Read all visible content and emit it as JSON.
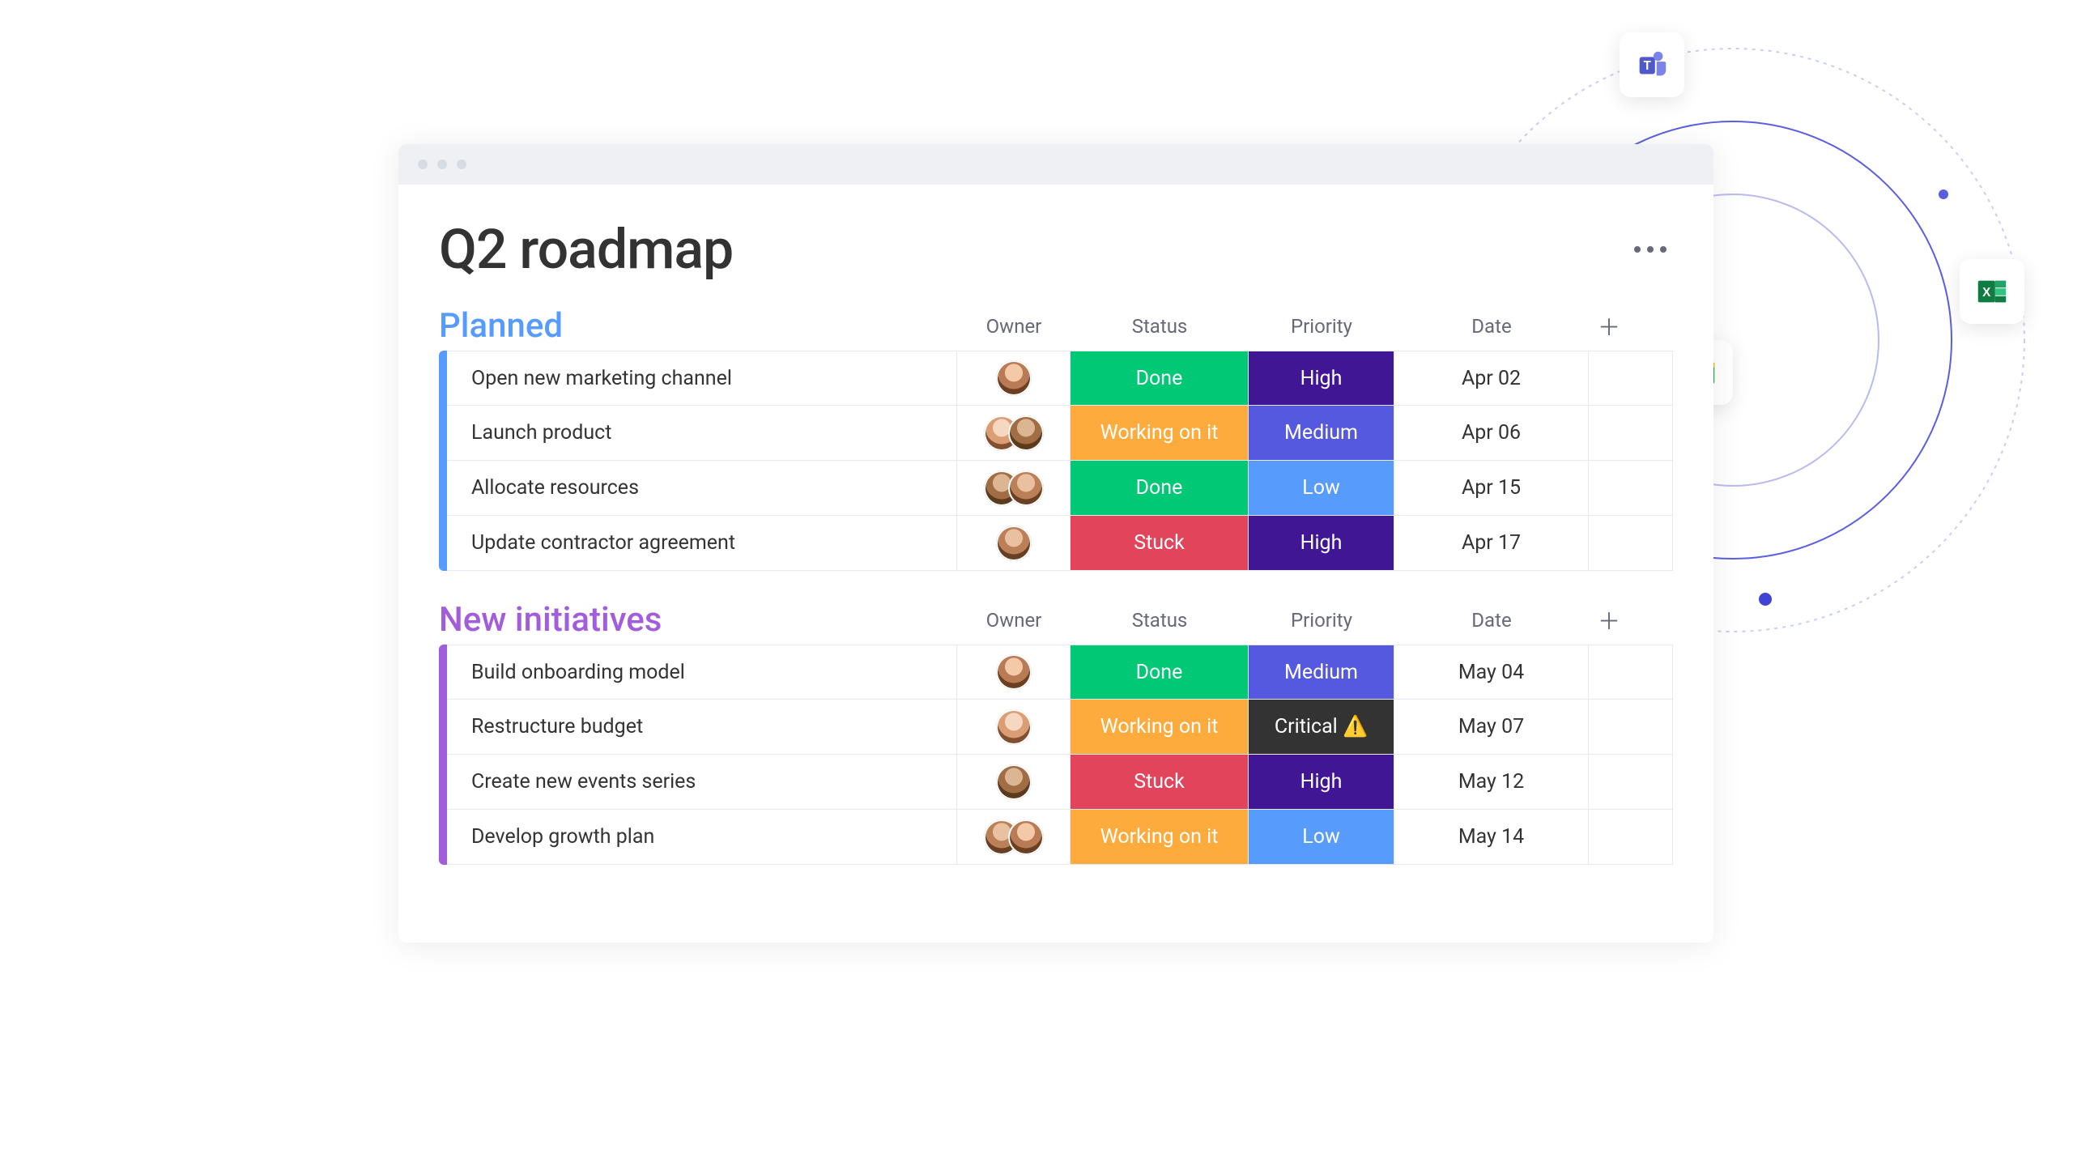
{
  "page": {
    "title": "Q2 roadmap"
  },
  "columns": {
    "owner": "Owner",
    "status": "Status",
    "priority": "Priority",
    "date": "Date"
  },
  "status_colors": {
    "Done": "#00c875",
    "Working on it": "#fdab3d",
    "Stuck": "#e2445c"
  },
  "priority_colors": {
    "High": "#401694",
    "Medium": "#5559df",
    "Low": "#579bfc",
    "Critical ⚠️": "#333333"
  },
  "groups": [
    {
      "name": "Planned",
      "color": "blue",
      "rows": [
        {
          "task": "Open new marketing channel",
          "owners": 1,
          "status": "Done",
          "priority": "High",
          "date": "Apr 02"
        },
        {
          "task": "Launch product",
          "owners": 2,
          "status": "Working on it",
          "priority": "Medium",
          "date": "Apr 06"
        },
        {
          "task": "Allocate resources",
          "owners": 2,
          "status": "Done",
          "priority": "Low",
          "date": "Apr 15"
        },
        {
          "task": "Update contractor agreement",
          "owners": 1,
          "status": "Stuck",
          "priority": "High",
          "date": "Apr 17"
        }
      ]
    },
    {
      "name": "New initiatives",
      "color": "purple",
      "rows": [
        {
          "task": "Build onboarding model",
          "owners": 1,
          "status": "Done",
          "priority": "Medium",
          "date": "May 04"
        },
        {
          "task": "Restructure budget",
          "owners": 1,
          "status": "Working on it",
          "priority": "Critical ⚠️",
          "date": "May 07"
        },
        {
          "task": "Create new events series",
          "owners": 1,
          "status": "Stuck",
          "priority": "High",
          "date": "May 12"
        },
        {
          "task": "Develop growth plan",
          "owners": 2,
          "status": "Working on it",
          "priority": "Low",
          "date": "May 14"
        }
      ]
    }
  ],
  "integrations": [
    "teams",
    "excel",
    "gmail"
  ]
}
